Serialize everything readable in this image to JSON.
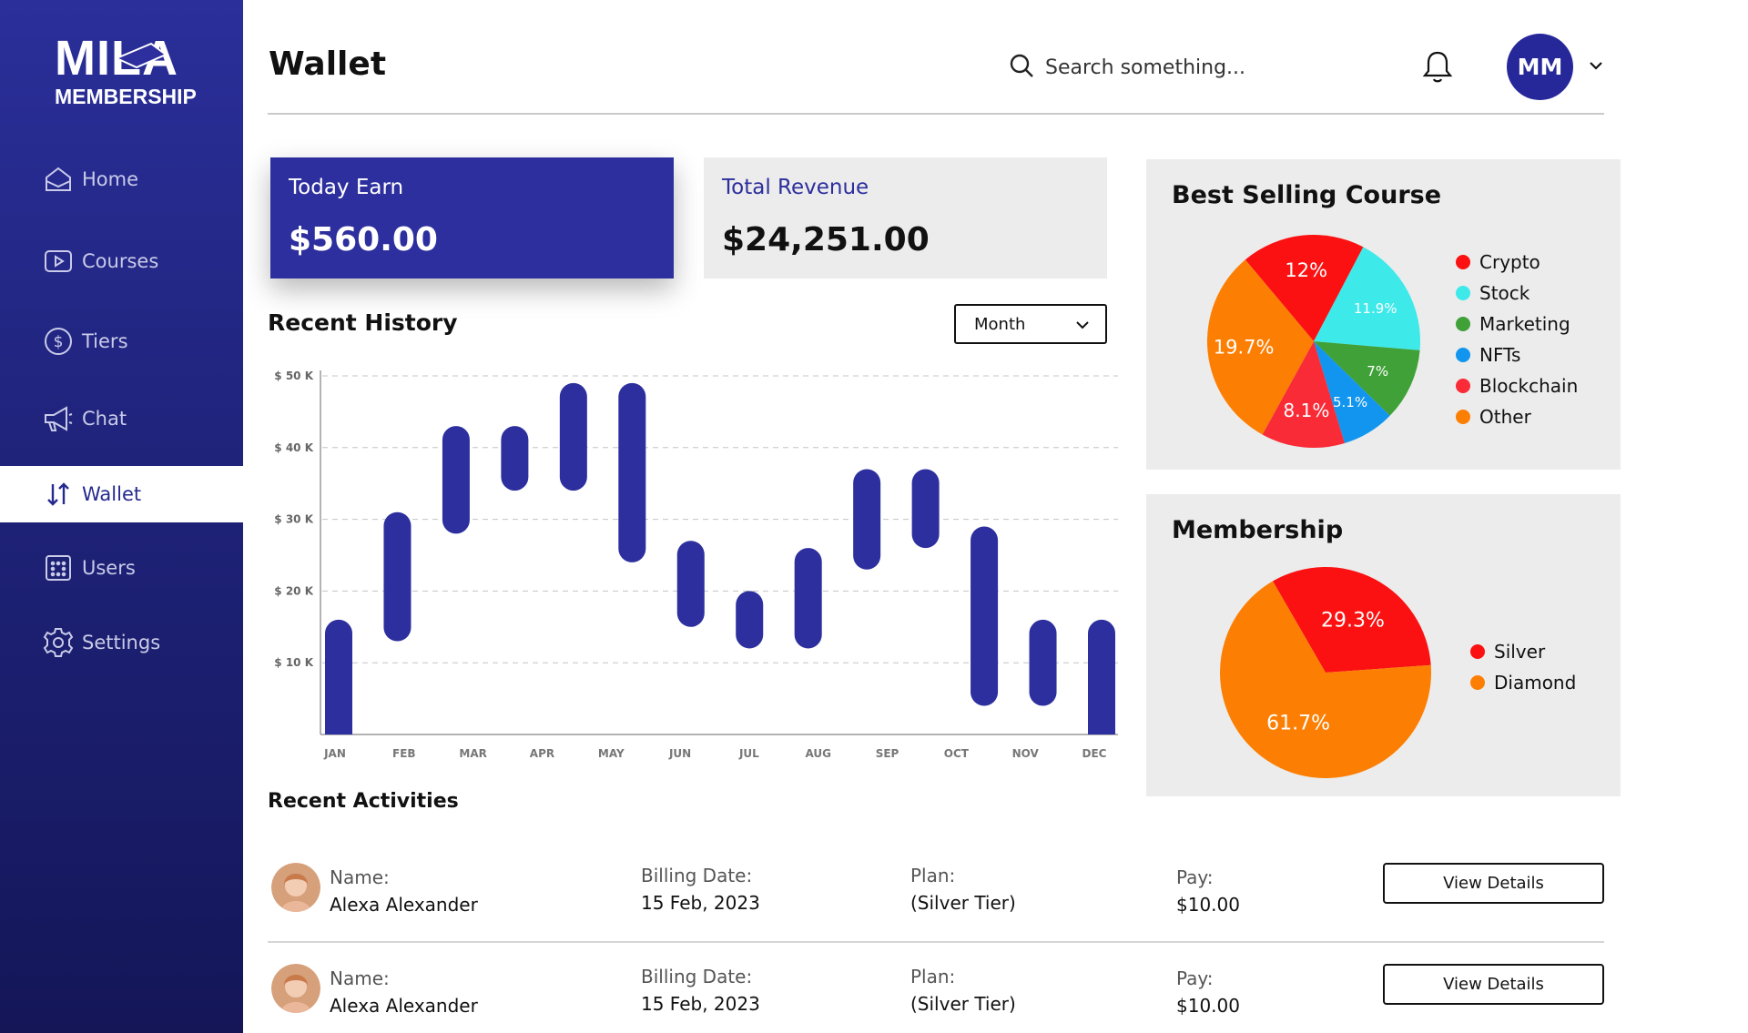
{
  "brand": {
    "logo_text": "MILA",
    "logo_subtext": "MEMBERSHIP"
  },
  "sidebar": {
    "items": [
      {
        "label": "Home",
        "icon": "home-icon"
      },
      {
        "label": "Courses",
        "icon": "play-icon"
      },
      {
        "label": "Tiers",
        "icon": "dollar-circle-icon"
      },
      {
        "label": "Chat",
        "icon": "megaphone-icon"
      },
      {
        "label": "Wallet",
        "icon": "sort-arrows-icon",
        "active": true
      },
      {
        "label": "Users",
        "icon": "users-box-icon"
      },
      {
        "label": "Settings",
        "icon": "gear-icon"
      }
    ]
  },
  "header": {
    "title": "Wallet",
    "search_placeholder": "Search something...",
    "user_initials": "MM"
  },
  "stats": {
    "today_earn_label": "Today Earn",
    "today_earn_value": "$560.00",
    "total_revenue_label": "Total Revenue",
    "total_revenue_value": "$24,251.00"
  },
  "history": {
    "title": "Recent History",
    "period_select": "Month"
  },
  "colors": {
    "brand": "#2c2f9d",
    "sidebar_dark": "#141658",
    "bar": "#2c2f9d",
    "red": "#fb1111",
    "cyan": "#3ee9ea",
    "green": "#3fa138",
    "blue": "#1195ee",
    "orange": "#fc7f03"
  },
  "chart_data": [
    {
      "type": "bar",
      "subtype": "floating-range",
      "title": "Recent History",
      "categories": [
        "JAN",
        "FEB",
        "MAR",
        "APR",
        "MAY",
        "JUN",
        "JUL",
        "AUG",
        "SEP",
        "OCT",
        "NOV",
        "DEC"
      ],
      "ranges": [
        [
          0,
          16
        ],
        [
          13,
          31
        ],
        [
          28,
          43
        ],
        [
          34,
          43
        ],
        [
          34,
          49
        ],
        [
          24,
          49
        ],
        [
          15,
          27
        ],
        [
          12,
          20
        ],
        [
          12,
          26
        ],
        [
          23,
          37
        ],
        [
          26,
          37
        ],
        [
          4,
          29
        ],
        [
          4,
          16
        ],
        [
          0,
          16
        ]
      ],
      "low": [
        0,
        13,
        28,
        34,
        34,
        24,
        15,
        12,
        12,
        23,
        26,
        4,
        4,
        0
      ],
      "high": [
        16,
        31,
        43,
        43,
        49,
        49,
        27,
        20,
        26,
        37,
        37,
        29,
        16,
        16
      ],
      "yticks": [
        "$ 10 K",
        "$ 20 K",
        "$ 30 K",
        "$ 40 K",
        "$ 50 K"
      ],
      "ytick_values": [
        10,
        20,
        30,
        40,
        50
      ],
      "ylim": [
        0,
        50
      ],
      "grid": true
    },
    {
      "type": "pie",
      "title": "Best Selling Course",
      "slices": [
        {
          "label": "Crypto",
          "value": 12,
          "display": "12%",
          "color": "#fb1111"
        },
        {
          "label": "Stock",
          "value": 11.9,
          "display": "11.9%",
          "color": "#3ee9ea"
        },
        {
          "label": "Marketing",
          "value": 7,
          "display": "7%",
          "color": "#3fa138"
        },
        {
          "label": "NFTs",
          "value": 5.1,
          "display": "5.1%",
          "color": "#1195ee"
        },
        {
          "label": "Blockchain",
          "value": 8.1,
          "display": "8.1%",
          "color": "#f92b36"
        },
        {
          "label": "Other",
          "value": 19.7,
          "display": "19.7%",
          "color": "#fc7f03"
        }
      ],
      "legend": "right"
    },
    {
      "type": "pie",
      "title": "Membership",
      "slices": [
        {
          "label": "Silver",
          "value": 29.3,
          "display": "29.3%",
          "color": "#fb1111"
        },
        {
          "label": "Diamond",
          "value": 61.7,
          "display": "61.7%",
          "color": "#fc7f03"
        }
      ],
      "legend": "right"
    }
  ],
  "activities": {
    "title": "Recent Activities",
    "rows": [
      {
        "name_label": "Name:",
        "name": "Alexa Alexander",
        "billing_label": "Billing Date:",
        "billing": "15 Feb, 2023",
        "plan_label": "Plan:",
        "plan": "(Silver Tier)",
        "pay_label": "Pay:",
        "pay": "$10.00",
        "button": "View Details"
      },
      {
        "name_label": "Name:",
        "name": "Alexa Alexander",
        "billing_label": "Billing Date:",
        "billing": "15 Feb, 2023",
        "plan_label": "Plan:",
        "plan": "(Silver Tier)",
        "pay_label": "Pay:",
        "pay": "$10.00",
        "button": "View Details"
      }
    ]
  }
}
